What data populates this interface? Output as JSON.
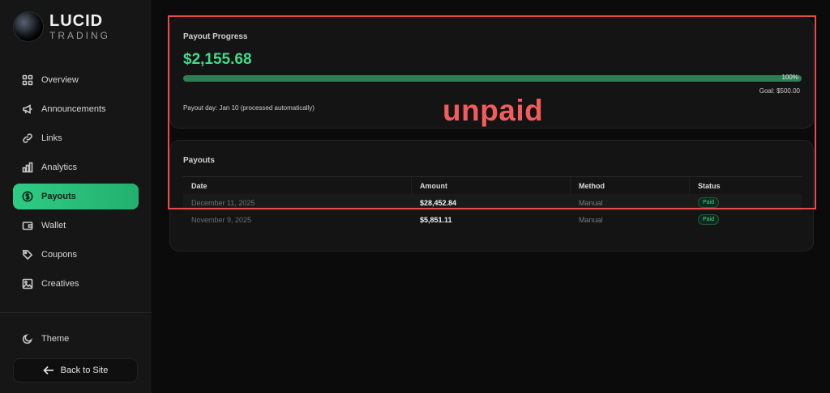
{
  "brand": {
    "name": "LUCID",
    "sub": "TRADING"
  },
  "sidebar": {
    "items": [
      {
        "label": "Overview",
        "icon": "grid-icon",
        "active": false
      },
      {
        "label": "Announcements",
        "icon": "megaphone-icon",
        "active": false
      },
      {
        "label": "Links",
        "icon": "link-icon",
        "active": false
      },
      {
        "label": "Analytics",
        "icon": "bar-chart-icon",
        "active": false
      },
      {
        "label": "Payouts",
        "icon": "dollar-circle-icon",
        "active": true
      },
      {
        "label": "Wallet",
        "icon": "wallet-icon",
        "active": false
      },
      {
        "label": "Coupons",
        "icon": "tag-icon",
        "active": false
      },
      {
        "label": "Creatives",
        "icon": "image-icon",
        "active": false
      }
    ],
    "theme_label": "Theme",
    "back_label": "Back to Site"
  },
  "progress": {
    "title": "Payout Progress",
    "amount": "$2,155.68",
    "percent_label": "100%",
    "percent": 100,
    "goal": "Goal: $500.00",
    "payout_day": "Payout day: Jan 10 (processed automatically)"
  },
  "payouts": {
    "title": "Payouts",
    "columns": [
      "Date",
      "Amount",
      "Method",
      "Status"
    ],
    "rows": [
      {
        "date": "December 11, 2025",
        "amount": "$28,452.84",
        "method": "Manual",
        "status": "Paid"
      },
      {
        "date": "November 9, 2025",
        "amount": "$5,851.11",
        "method": "Manual",
        "status": "Paid"
      }
    ]
  },
  "annotation": {
    "label": "unpaid",
    "color": "#e94b4b"
  },
  "colors": {
    "accent": "#2ecc85",
    "amount": "#3ddc8a"
  }
}
